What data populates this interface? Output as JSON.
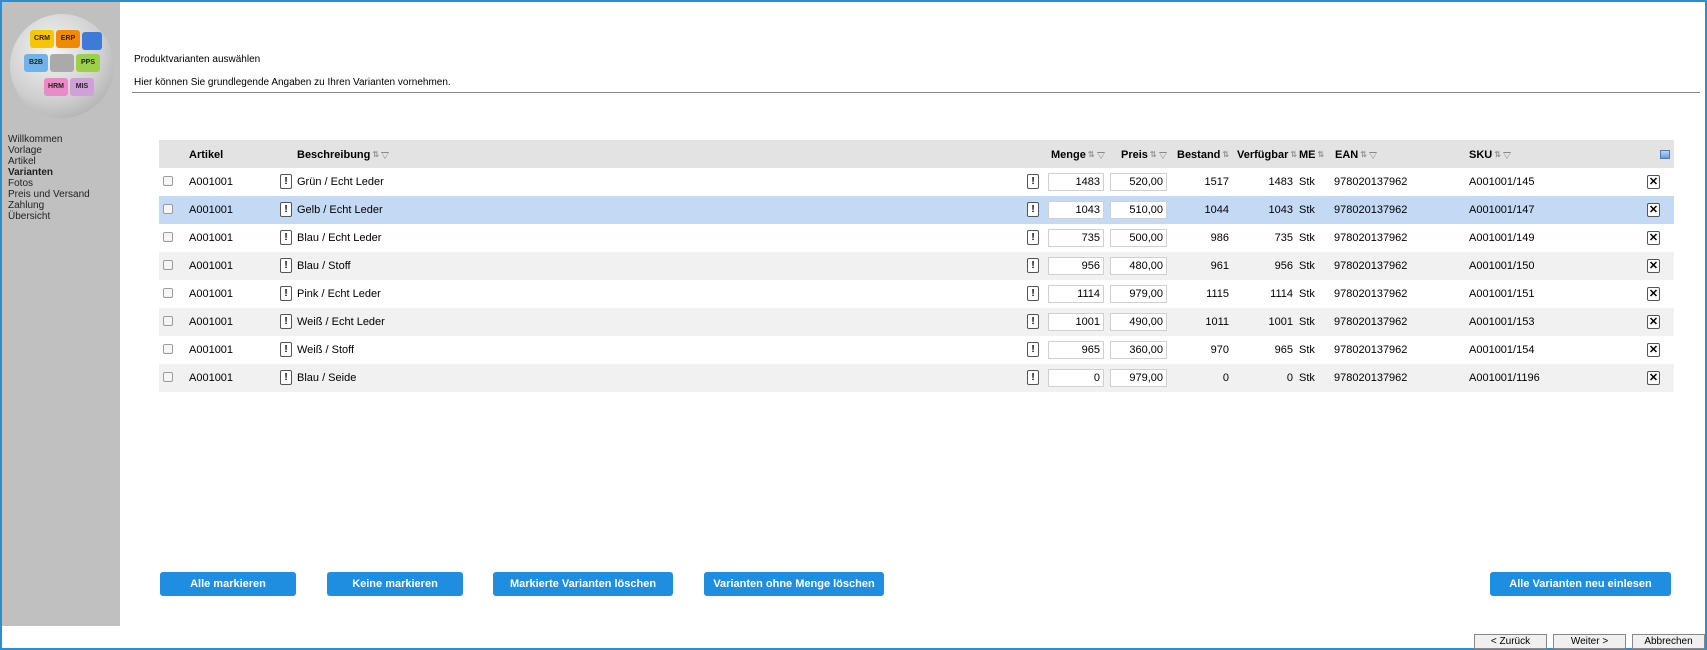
{
  "header": {
    "title": "Produktvarianten auswählen",
    "subtitle": "Hier können Sie grundlegende Angaben zu Ihren Varianten vornehmen."
  },
  "logo_pieces": [
    "CRM",
    "ERP",
    "B2B",
    "PPS",
    "HRM",
    "MIS"
  ],
  "sidebar": {
    "items": [
      {
        "label": "Willkommen",
        "active": false
      },
      {
        "label": "Vorlage",
        "active": false
      },
      {
        "label": "Artikel",
        "active": false
      },
      {
        "label": "Varianten",
        "active": true
      },
      {
        "label": "Fotos",
        "active": false
      },
      {
        "label": "Preis und Versand",
        "active": false
      },
      {
        "label": "Zahlung",
        "active": false
      },
      {
        "label": "Übersicht",
        "active": false
      }
    ]
  },
  "table": {
    "columns": {
      "artikel": "Artikel",
      "beschreibung": "Beschreibung",
      "menge": "Menge",
      "preis": "Preis",
      "bestand": "Bestand",
      "verfuegbar": "Verfügbar",
      "me": "ME",
      "ean": "EAN",
      "sku": "SKU"
    },
    "rows": [
      {
        "artikel": "A001001",
        "beschreibung": "Grün / Echt Leder",
        "menge": "1483",
        "preis": "520,00",
        "bestand": "1517",
        "verfuegbar": "1483",
        "me": "Stk",
        "ean": "978020137962",
        "sku": "A001001/145",
        "selected": false
      },
      {
        "artikel": "A001001",
        "beschreibung": "Gelb / Echt Leder",
        "menge": "1043",
        "preis": "510,00",
        "bestand": "1044",
        "verfuegbar": "1043",
        "me": "Stk",
        "ean": "978020137962",
        "sku": "A001001/147",
        "selected": true
      },
      {
        "artikel": "A001001",
        "beschreibung": "Blau / Echt Leder",
        "menge": "735",
        "preis": "500,00",
        "bestand": "986",
        "verfuegbar": "735",
        "me": "Stk",
        "ean": "978020137962",
        "sku": "A001001/149",
        "selected": false
      },
      {
        "artikel": "A001001",
        "beschreibung": "Blau / Stoff",
        "menge": "956",
        "preis": "480,00",
        "bestand": "961",
        "verfuegbar": "956",
        "me": "Stk",
        "ean": "978020137962",
        "sku": "A001001/150",
        "selected": false
      },
      {
        "artikel": "A001001",
        "beschreibung": "Pink / Echt Leder",
        "menge": "1114",
        "preis": "979,00",
        "bestand": "1115",
        "verfuegbar": "1114",
        "me": "Stk",
        "ean": "978020137962",
        "sku": "A001001/151",
        "selected": false
      },
      {
        "artikel": "A001001",
        "beschreibung": "Weiß / Echt Leder",
        "menge": "1001",
        "preis": "490,00",
        "bestand": "1011",
        "verfuegbar": "1001",
        "me": "Stk",
        "ean": "978020137962",
        "sku": "A001001/153",
        "selected": false
      },
      {
        "artikel": "A001001",
        "beschreibung": "Weiß / Stoff",
        "menge": "965",
        "preis": "360,00",
        "bestand": "970",
        "verfuegbar": "965",
        "me": "Stk",
        "ean": "978020137962",
        "sku": "A001001/154",
        "selected": false
      },
      {
        "artikel": "A001001",
        "beschreibung": "Blau / Seide",
        "menge": "0",
        "preis": "979,00",
        "bestand": "0",
        "verfuegbar": "0",
        "me": "Stk",
        "ean": "978020137962",
        "sku": "A001001/1196",
        "selected": false
      }
    ]
  },
  "actions": {
    "select_all": "Alle markieren",
    "select_none": "Keine markieren",
    "delete_marked": "Markierte Varianten löschen",
    "delete_no_qty": "Varianten ohne Menge löschen",
    "reload_all": "Alle Varianten neu einlesen"
  },
  "navigation": {
    "back": "< Zurück",
    "next": "Weiter >",
    "cancel": "Abbrechen"
  },
  "info_button_label": "!",
  "delete_icon_label": "✕",
  "colors": {
    "accent": "#1f8de0",
    "frame_border": "#2a8fd0",
    "sidebar_bg": "#c0c0c0",
    "header_bg": "#e3e3e3",
    "row_selected": "#c4daf4",
    "row_alt": "#f1f1f1"
  }
}
